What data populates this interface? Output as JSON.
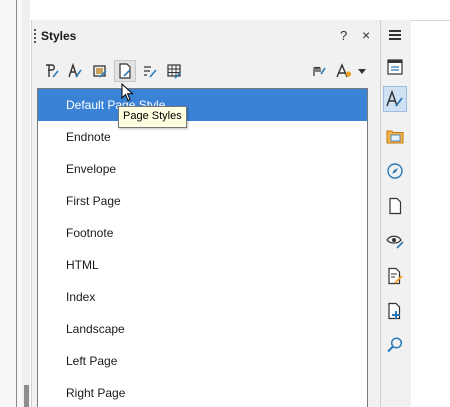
{
  "panel": {
    "title": "Styles",
    "help_label": "?",
    "close_label": "×"
  },
  "toolbar": {
    "buttons": [
      {
        "name": "paragraph-styles-icon"
      },
      {
        "name": "character-styles-icon"
      },
      {
        "name": "frame-styles-icon"
      },
      {
        "name": "page-styles-icon"
      },
      {
        "name": "list-styles-icon"
      },
      {
        "name": "table-styles-icon"
      },
      {
        "name": "fill-format-mode-icon"
      },
      {
        "name": "new-style-icon"
      }
    ],
    "tooltip": "Page Styles"
  },
  "styles_list": {
    "items": [
      "Default Page Style",
      "Endnote",
      "Envelope",
      "First Page",
      "Footnote",
      "HTML",
      "Index",
      "Landscape",
      "Left Page",
      "Right Page"
    ],
    "selected_index": 0
  },
  "deck": {
    "tabs": [
      "properties-icon",
      "styles-icon",
      "gallery-icon",
      "navigator-icon",
      "page-icon",
      "style-inspector-icon",
      "manage-changes-icon",
      "design-icon",
      "find-icon"
    ],
    "active_tab": "styles-icon"
  },
  "colors": {
    "accent": "#3a82d6",
    "tooltip_bg": "#ffffe1",
    "panel_bg": "#f1f1f1"
  }
}
